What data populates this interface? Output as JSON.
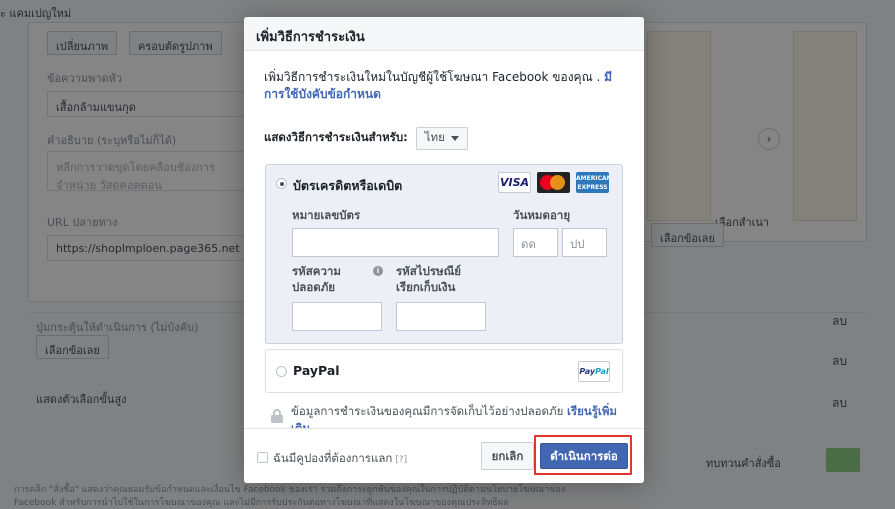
{
  "background": {
    "crumb": "ะ แคมเปญใหม่",
    "tabs": [
      "เปลี่ยนภาพ",
      "ครอบตัดรูปภาพ"
    ],
    "headline_label": "ข้อความพาดหัว",
    "headline_value": "เสื้อกล้ามแขนกุด",
    "description_label": "คำอธิบาย (ระบุหรือไม่ก็ได้)",
    "description_value": "หลีกการวาดขุดโดยคลือบช้องการจำหน่าย วัสดุคอตตอน",
    "url_label": "URL ปลายทาง",
    "url_value": "https://shoplmploen.page365.net",
    "cta_label": "ปุ่มกระตุ้นให้ดำเนินการ (ไม่บังคับ)",
    "cta_value": "เลือกข้อเลย",
    "more_options": "แสดงตัวเลือกขั้นสูง",
    "right_card_label": "เลือกสำเนา",
    "right_card_button": "เลือกข้อเลย",
    "delete_labels": [
      "ลบ",
      "ลบ",
      "ลบ"
    ],
    "footer_right": "ทบทวนคำสั่งซื้อ",
    "footnote_line1": "การคลิก \"สั่งซื้อ\" แสดงว่าคุณยอมรับข้อกำหนดและเงื่อนไข Facebook ของเรา รวมถึงภาระผูกพันของคุณในการปฏิบัติตามนโยบายโฆษณาของ",
    "footnote_line2": "Facebook สำหรับการนำไปใช้ในการโฆษณาของคุณ และไม่มีการรับประกันต่อทางโฆษณาที่แสดงในโฆษณาของคุณประสิทธิผล"
  },
  "modal": {
    "title": "เพิ่มวิธีการชำระเงิน",
    "intro_text": "เพิ่มวิธีการชำระเงินใหม่ในบัญชีผู้ใช้โฆษณา Facebook ของคุณ . ",
    "intro_link": "มีการใช้บังคับข้อกำหนด",
    "show_methods_label": "แสดงวิธีการชำระเงินสำหรับ:",
    "country_selected": "ไทย",
    "card_option": {
      "title": "บัตรเครดิตหรือเดบิต",
      "selected": true,
      "logos": [
        "visa-logo",
        "mastercard-logo",
        "amex-logo"
      ],
      "visa_text": "VISA",
      "amex_text": "AMERICAN EXPRESS",
      "card_number_label": "หมายเลขบัตร",
      "expiry_label": "วันหมดอายุ",
      "month_placeholder": "ดด",
      "year_placeholder": "ปป",
      "security_code_label_1": "รหัสความ",
      "security_code_label_2": "ปลอดภัย",
      "billing_zip_label_1": "รหัสไปรษณีย์",
      "billing_zip_label_2": "เรียกเก็บเงิน"
    },
    "paypal_option": {
      "title": "PayPal",
      "selected": false,
      "logo_text_a": "Pay",
      "logo_text_b": "Pal"
    },
    "secure_text": "ข้อมูลการชำระเงินของคุณมีการจัดเก็บไว้อย่างปลอดภัย ",
    "secure_link": "เรียนรู้เพิ่มเติม",
    "coupon_label": "ฉันมีคูปองที่ต้องการแลก",
    "coupon_hint": "[?]",
    "cancel_button": "ยกเลิก",
    "continue_button": "ดำเนินการต่อ",
    "highlight_color": "#e0362c",
    "primary_color": "#4267b2"
  }
}
